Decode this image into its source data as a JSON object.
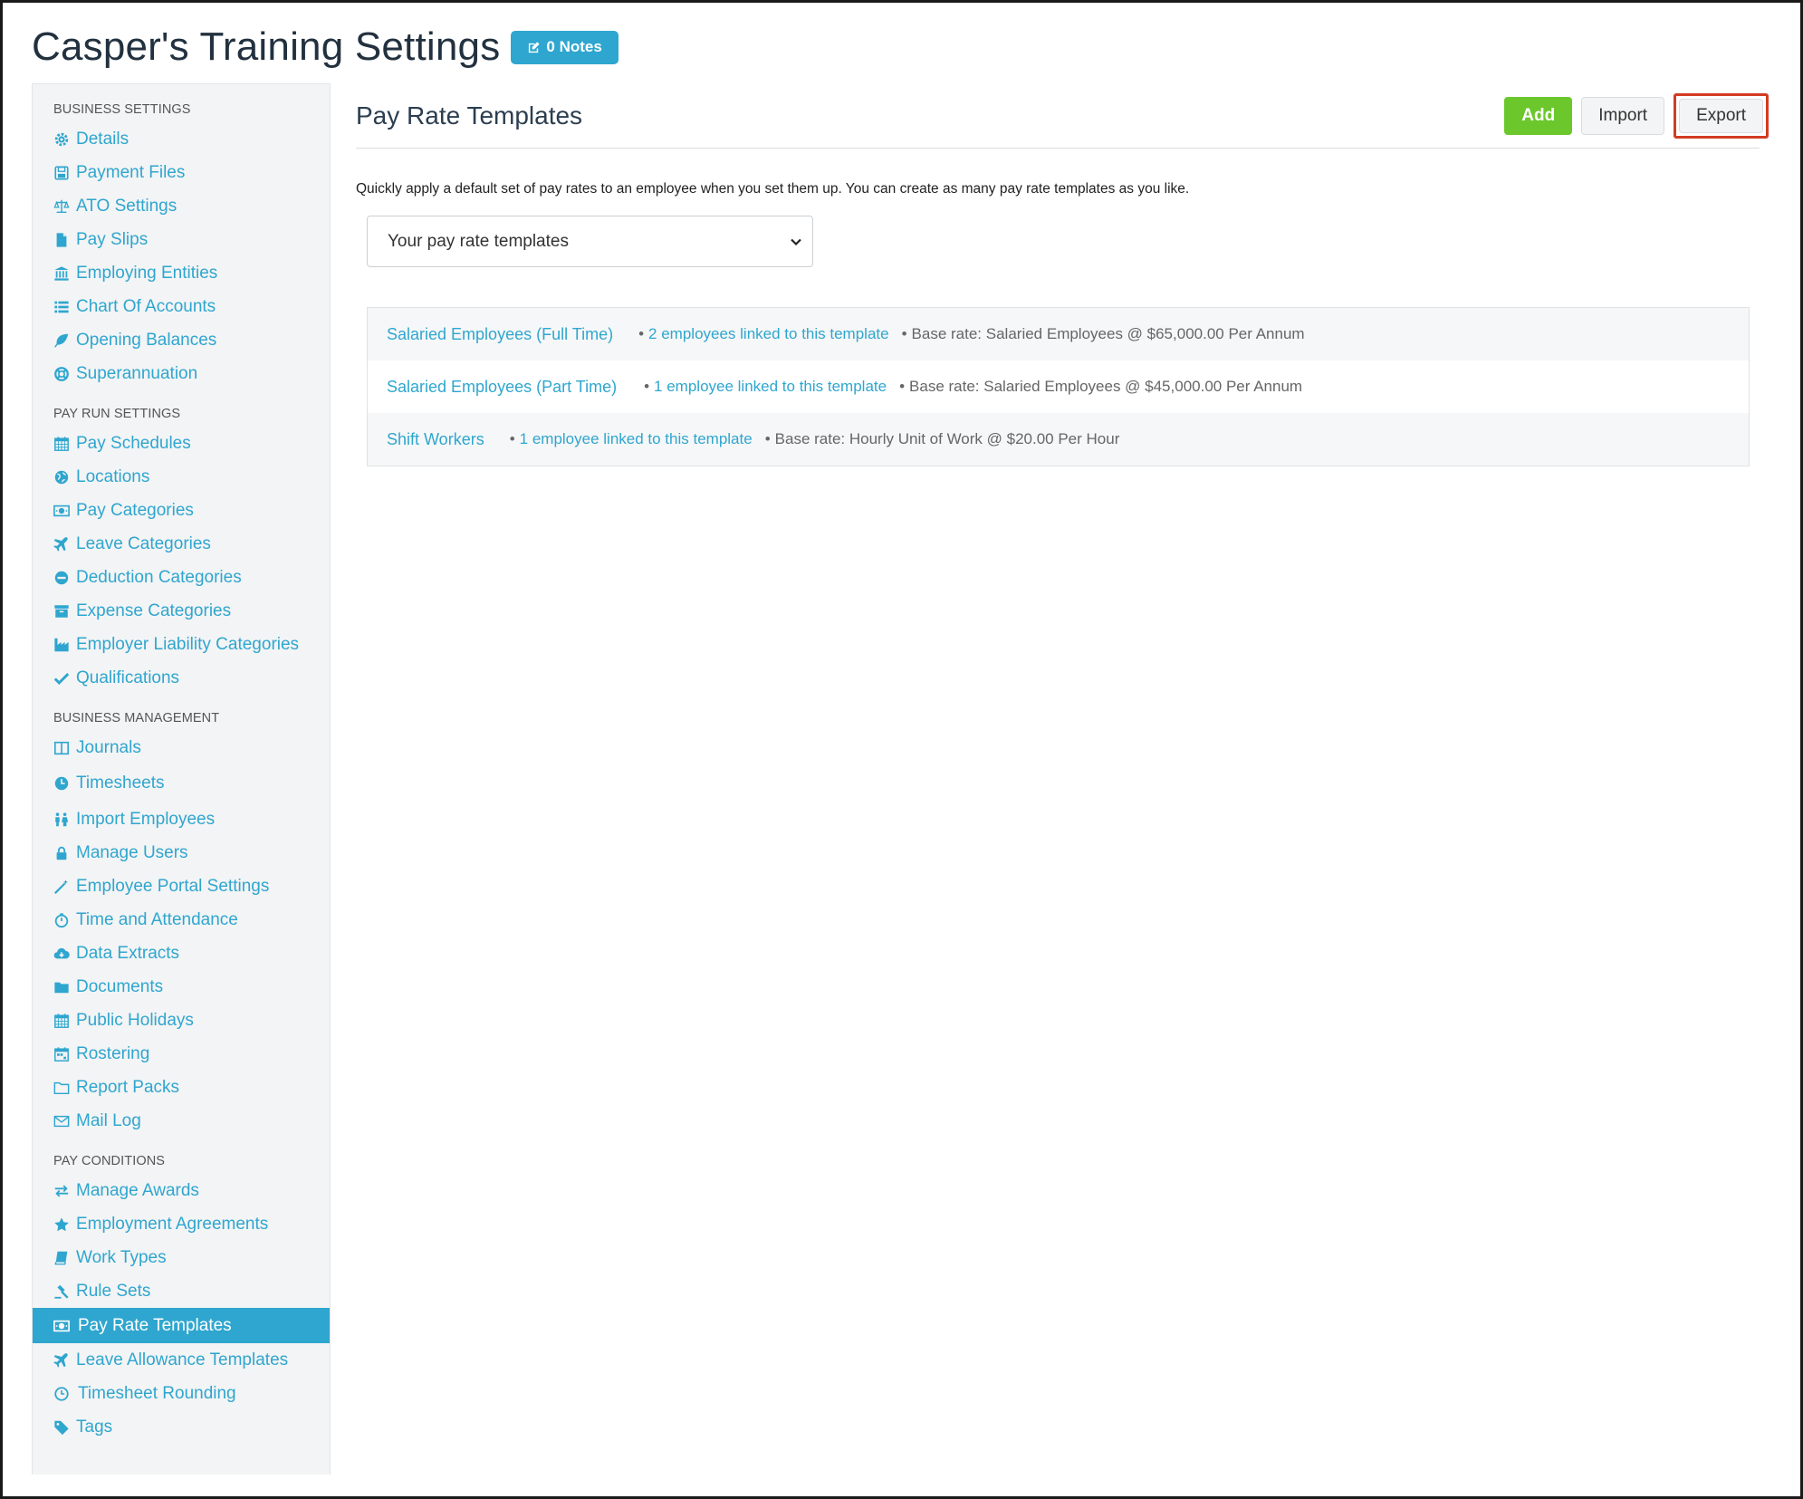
{
  "header": {
    "title": "Casper's Training Settings",
    "notes_label": "0 Notes"
  },
  "sidebar": {
    "sections": [
      {
        "heading": "BUSINESS SETTINGS",
        "items": [
          {
            "label": "Details",
            "icon": "gear-icon"
          },
          {
            "label": "Payment Files",
            "icon": "floppy-icon"
          },
          {
            "label": "ATO Settings",
            "icon": "scale-icon"
          },
          {
            "label": "Pay Slips",
            "icon": "file-icon"
          },
          {
            "label": "Employing Entities",
            "icon": "bank-icon"
          },
          {
            "label": "Chart Of Accounts",
            "icon": "list-icon"
          },
          {
            "label": "Opening Balances",
            "icon": "leaf-icon"
          },
          {
            "label": "Superannuation",
            "icon": "life-ring-icon"
          }
        ]
      },
      {
        "heading": "PAY RUN SETTINGS",
        "items": [
          {
            "label": "Pay Schedules",
            "icon": "calendar-icon"
          },
          {
            "label": "Locations",
            "icon": "globe-icon"
          },
          {
            "label": "Pay Categories",
            "icon": "money-icon"
          },
          {
            "label": "Leave Categories",
            "icon": "plane-icon"
          },
          {
            "label": "Deduction Categories",
            "icon": "minus-circle-icon"
          },
          {
            "label": "Expense Categories",
            "icon": "archive-icon"
          },
          {
            "label": "Employer Liability Categories",
            "icon": "industry-icon"
          },
          {
            "label": "Qualifications",
            "icon": "check-icon"
          }
        ]
      },
      {
        "heading": "BUSINESS MANAGEMENT",
        "items": [
          {
            "label": "Journals",
            "icon": "columns-icon"
          },
          {
            "label": "Timesheets",
            "icon": "clock-pie-icon"
          },
          {
            "label": "Import Employees",
            "icon": "people-icon"
          },
          {
            "label": "Manage Users",
            "icon": "lock-icon"
          },
          {
            "label": "Employee Portal Settings",
            "icon": "wand-icon"
          },
          {
            "label": "Time and Attendance",
            "icon": "stopwatch-icon"
          },
          {
            "label": "Data Extracts",
            "icon": "cloud-download-icon"
          },
          {
            "label": "Documents",
            "icon": "folder-icon"
          },
          {
            "label": "Public Holidays",
            "icon": "calendar-icon"
          },
          {
            "label": "Rostering",
            "icon": "calendar-grid-icon"
          },
          {
            "label": "Report Packs",
            "icon": "folder-open-icon"
          },
          {
            "label": "Mail Log",
            "icon": "envelope-icon"
          }
        ]
      },
      {
        "heading": "PAY CONDITIONS",
        "items": [
          {
            "label": "Manage Awards",
            "icon": "exchange-icon"
          },
          {
            "label": "Employment Agreements",
            "icon": "star-icon"
          },
          {
            "label": "Work Types",
            "icon": "book-icon"
          },
          {
            "label": "Rule Sets",
            "icon": "gavel-icon"
          },
          {
            "label": "Pay Rate Templates",
            "icon": "money-icon",
            "active": true
          },
          {
            "label": "Leave Allowance Templates",
            "icon": "plane-icon"
          },
          {
            "label": "Timesheet Rounding",
            "icon": "clock-icon"
          },
          {
            "label": "Tags",
            "icon": "tag-icon"
          }
        ]
      }
    ]
  },
  "main": {
    "title": "Pay Rate Templates",
    "buttons": {
      "add": "Add",
      "import": "Import",
      "export": "Export"
    },
    "intro": "Quickly apply a default set of pay rates to an employee when you set them up. You can create as many pay rate templates as you like.",
    "select_value": "Your pay rate templates",
    "templates": [
      {
        "name": "Salaried Employees (Full Time)",
        "linked": "2 employees linked to this template",
        "base": "Base rate: Salaried Employees @ $65,000.00 Per Annum"
      },
      {
        "name": "Salaried Employees (Part Time)",
        "linked": "1 employee linked to this template",
        "base": "Base rate: Salaried Employees @ $45,000.00 Per Annum"
      },
      {
        "name": "Shift Workers",
        "linked": "1 employee linked to this template",
        "base": "Base rate: Hourly Unit of Work @ $20.00 Per Hour"
      }
    ]
  },
  "colors": {
    "accent": "#2fa6cf",
    "add_button": "#6cc72d",
    "highlight_border": "#d33b22"
  }
}
